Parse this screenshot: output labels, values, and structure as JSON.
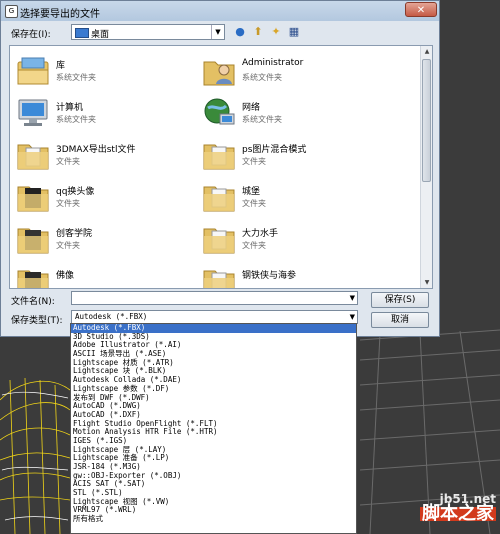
{
  "dialog": {
    "title": "选择要导出的文件",
    "save_in_label": "保存在(I):",
    "location": "桌面"
  },
  "toolbar": {
    "icons": [
      "back-icon",
      "up-folder-icon",
      "new-folder-icon",
      "view-menu-icon"
    ]
  },
  "files": [
    {
      "name": "库",
      "type": "系统文件夹",
      "icon": "library-icon"
    },
    {
      "name": "Administrator",
      "type": "系统文件夹",
      "icon": "user-folder-icon"
    },
    {
      "name": "计算机",
      "type": "系统文件夹",
      "icon": "computer-icon"
    },
    {
      "name": "网络",
      "type": "系统文件夹",
      "icon": "network-icon"
    },
    {
      "name": "3DMAX导出stl文件",
      "type": "文件夹",
      "icon": "folder-icon"
    },
    {
      "name": "ps图片混合模式",
      "type": "文件夹",
      "icon": "folder-icon"
    },
    {
      "name": "qq换头像",
      "type": "文件夹",
      "icon": "folder-icon"
    },
    {
      "name": "城堡",
      "type": "文件夹",
      "icon": "folder-icon"
    },
    {
      "name": "创客学院",
      "type": "文件夹",
      "icon": "folder-icon"
    },
    {
      "name": "大力水手",
      "type": "文件夹",
      "icon": "folder-icon"
    },
    {
      "name": "佛像",
      "type": "",
      "icon": "folder-icon"
    },
    {
      "name": "钢铁侠与海参",
      "type": "",
      "icon": "folder-icon"
    }
  ],
  "form": {
    "filename_label": "文件名(N):",
    "filename_value": "",
    "filetype_label": "保存类型(T):",
    "filetype_value": "Autodesk (*.FBX)",
    "save_label": "保存(S)",
    "cancel_label": "取消"
  },
  "file_types": [
    "Autodesk (*.FBX)",
    "3D Studio (*.3DS)",
    "Adobe Illustrator (*.AI)",
    "ASCII 场景导出 (*.ASE)",
    "Lightscape 材质 (*.ATR)",
    "Lightscape 块 (*.BLK)",
    "Autodesk Collada (*.DAE)",
    "Lightscape 参数 (*.DF)",
    "发布到 DWF (*.DWF)",
    "AutoCAD (*.DWG)",
    "AutoCAD (*.DXF)",
    "Flight Studio OpenFlight (*.FLT)",
    "Motion Analysis HTR File (*.HTR)",
    "IGES (*.IGS)",
    "Lightscape 层 (*.LAY)",
    "Lightscape 准备 (*.LP)",
    "JSR-184 (*.M3G)",
    "gw::OBJ-Exporter (*.OBJ)",
    "ACIS SAT (*.SAT)",
    "STL (*.STL)",
    "Lightscape 视图 (*.VW)",
    "VRML97 (*.WRL)",
    "所有格式"
  ],
  "selected_type_index": 0,
  "watermark": {
    "domain": "jb51.net",
    "text": "脚本之家"
  },
  "colors": {
    "selection": "#3a70c8",
    "title_bar": "#b3c8df",
    "close_button": "#c55a45"
  }
}
